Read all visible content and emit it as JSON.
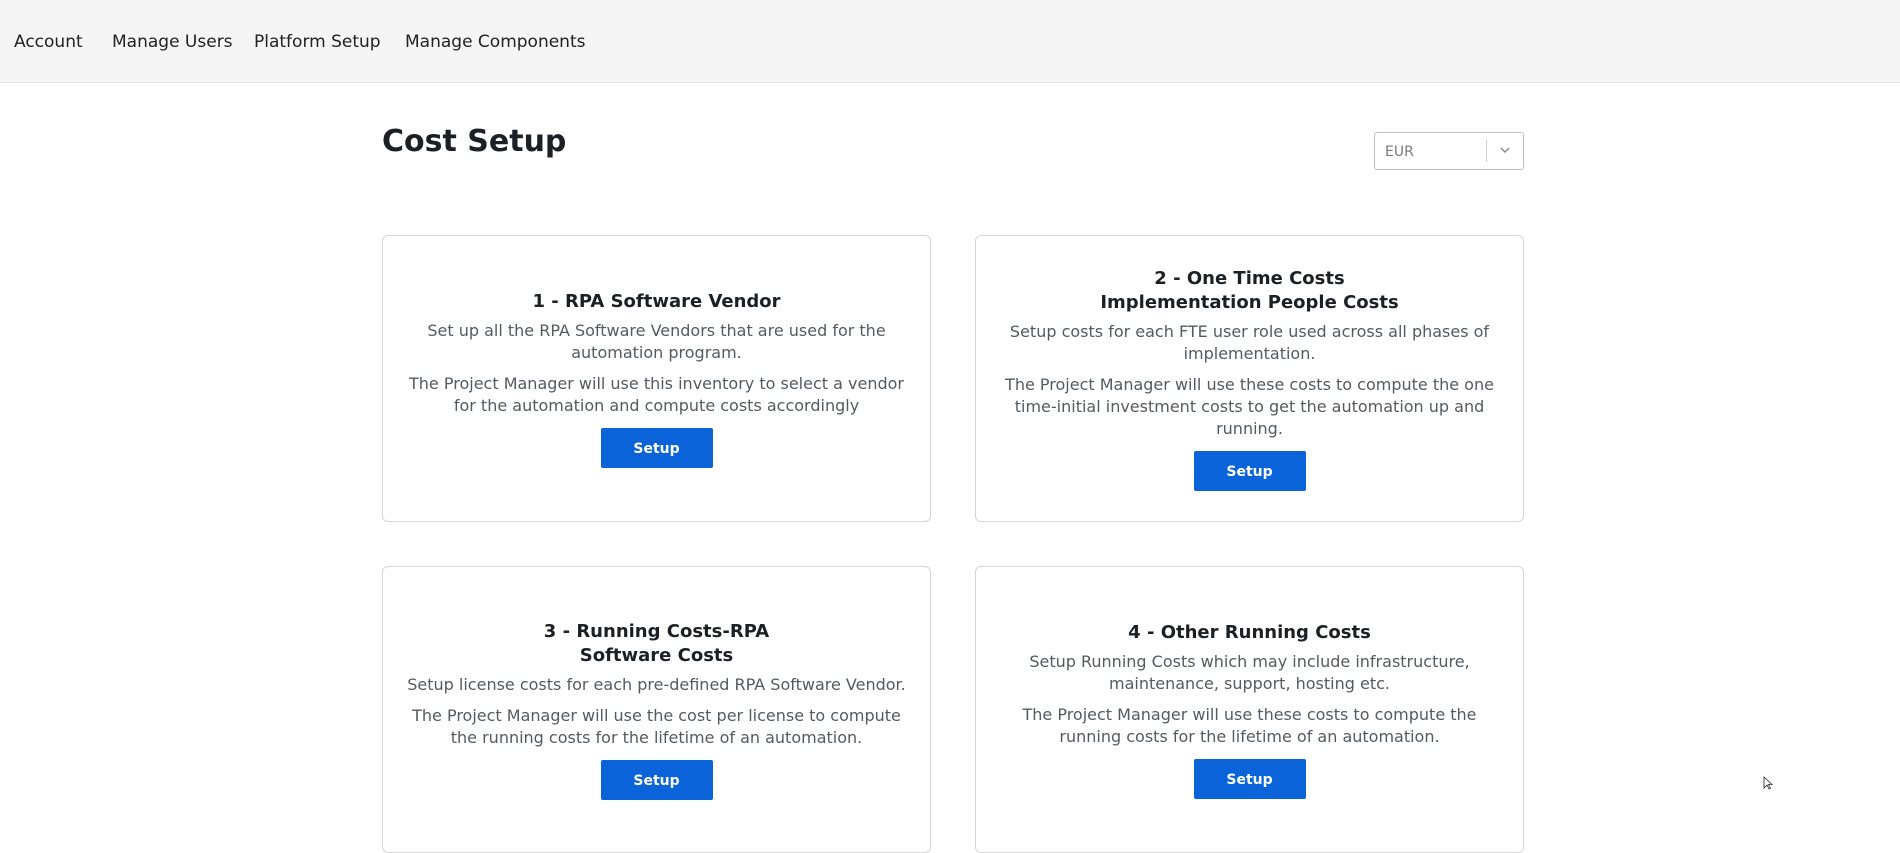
{
  "nav": {
    "items": [
      {
        "label": "Account"
      },
      {
        "label": "Manage Users"
      },
      {
        "label": "Platform Setup"
      },
      {
        "label": "Manage Components"
      }
    ]
  },
  "page": {
    "title": "Cost Setup"
  },
  "currency": {
    "selected": "EUR"
  },
  "cards": [
    {
      "title_lines": [
        "1 - RPA Software Vendor"
      ],
      "desc1": "Set up all the RPA Software Vendors that are used for the automation program.",
      "desc2": "The Project Manager will use this inventory to select a vendor for the automation and compute costs accordingly",
      "button": "Setup"
    },
    {
      "title_lines": [
        "2 - One Time Costs",
        "Implementation People Costs"
      ],
      "desc1": "Setup costs for each FTE user role used across all phases of implementation.",
      "desc2": "The Project Manager will use these costs to compute the one time-initial investment costs to get the automation up and running.",
      "button": "Setup"
    },
    {
      "title_lines": [
        "3 - Running Costs-RPA",
        "Software Costs"
      ],
      "desc1": "Setup license costs for each pre-defined RPA Software Vendor.",
      "desc2": "The Project Manager will use the cost per license to compute the running costs for the lifetime of an automation.",
      "button": "Setup"
    },
    {
      "title_lines": [
        "4 - Other Running Costs"
      ],
      "desc1": "Setup Running Costs which may include infrastructure, maintenance, support, hosting etc.",
      "desc2": "The Project Manager will use these costs to compute the running costs for the lifetime of an automation.",
      "button": "Setup"
    }
  ]
}
